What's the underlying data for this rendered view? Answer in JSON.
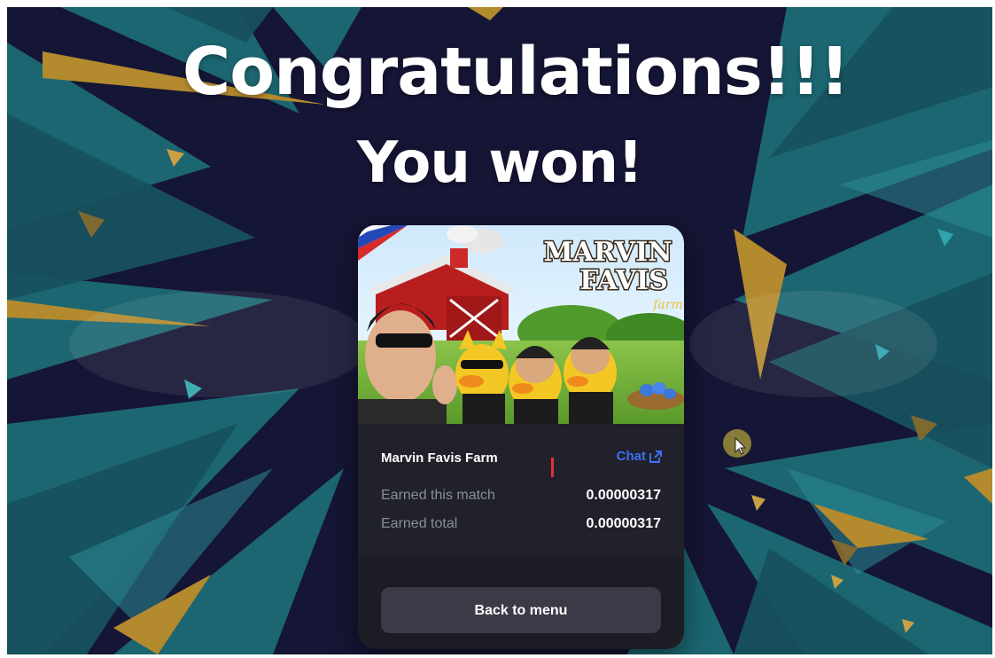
{
  "headline": {
    "line1": "Congratulations!!!",
    "line2": "You won!"
  },
  "card": {
    "art": {
      "logo_line1": "MARVIN",
      "logo_line2": "FAVIS",
      "logo_script": "farm",
      "flag": "philippines-flag"
    },
    "farm_name": "Marvin Favis Farm",
    "chat_label": "Chat",
    "chat_icon": "external-link-icon",
    "stats": [
      {
        "label": "Earned this match",
        "value": "0.00000317"
      },
      {
        "label": "Earned total",
        "value": "0.00000317"
      }
    ],
    "back_label": "Back to menu"
  },
  "colors": {
    "background": "#151535",
    "card": "#1b1c24",
    "card_info": "#20212b",
    "accent_link": "#3d6ff0",
    "button": "#3a3b47",
    "marker": "#e0303a"
  }
}
